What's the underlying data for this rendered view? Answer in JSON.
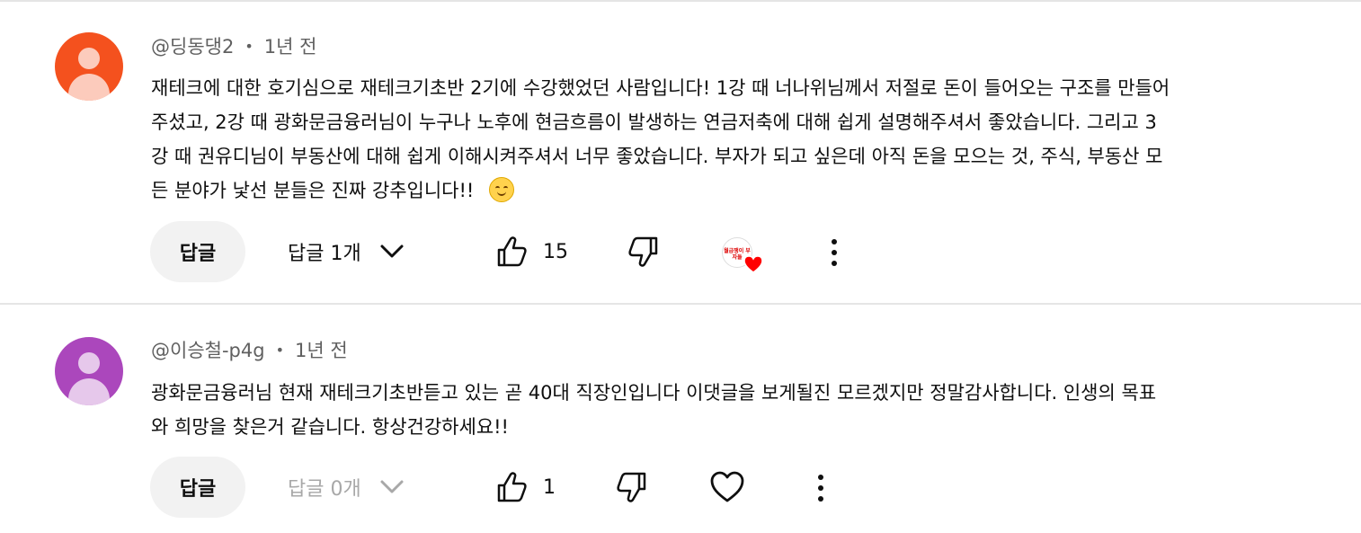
{
  "comments": [
    {
      "author": "@딩동댕2",
      "separator": "•",
      "time": "1년 전",
      "avatar_color": "#f4511e",
      "lines": [
        "재테크에 대한 호기심으로 재테크기초반 2기에 수강했었던 사람입니다! 1강 때 너나위님께서 저절로 돈이 들어오는 구조를 만들어",
        "주셨고, 2강 때 광화문금융러님이 누구나 노후에 현금흐름이 발생하는 연금저축에 대해 쉽게 설명해주셔서 좋았습니다. 그리고 3",
        "강 때 권유디님이 부동산에 대해 쉽게 이해시켜주셔서 너무 좋았습니다. 부자가 되고 싶은데 아직 돈을 모으는 것, 주식, 부동산 모",
        "든 분야가 낯선 분들은 진짜 강추입니다!! "
      ],
      "emoji": "smiling-face-emoji",
      "reply_label": "답글",
      "replies_label": "답글 1개",
      "likes": "15",
      "creator_avatar_text": "월급쟁이 부자들",
      "creator_heart_color": "#ff0000"
    },
    {
      "author": "@이승철-p4g",
      "separator": "•",
      "time": "1년 전",
      "avatar_color": "#ab47bc",
      "lines": [
        "광화문금융러님 현재 재테크기초반듣고 있는 곧 40대 직장인입니다 이댓글을 보게될진 모르겠지만 정말감사합니다. 인생의  목표",
        "와 희망을 찾은거 같습니다. 항상건강하세요!!"
      ],
      "reply_label": "답글",
      "replies_label": "답글 0개",
      "likes": "1"
    }
  ],
  "icons": {
    "like": "thumbs-up-icon",
    "dislike": "thumbs-down-icon",
    "heart": "heart-icon",
    "more": "more-vert-icon",
    "chevron": "chevron-down-icon"
  }
}
